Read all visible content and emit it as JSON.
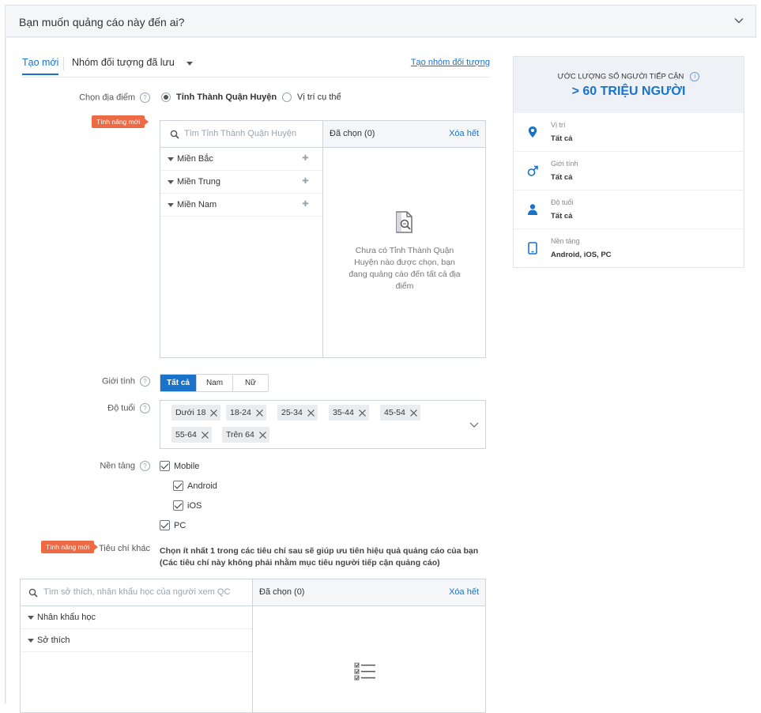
{
  "header": {
    "title": "Bạn muốn quảng cáo này đến ai?"
  },
  "tabs": {
    "new": "Tạo mới",
    "saved": "Nhóm đối tượng đã lưu",
    "create_link": "Tạo nhóm đối tượng"
  },
  "location": {
    "label": "Chọn địa điểm",
    "new_badge": "Tính năng mới",
    "options": [
      "Tỉnh Thành Quận Huyện",
      "Vị trí cụ thể"
    ],
    "search_placeholder": "Tìm Tỉnh Thành Quận Huyện",
    "regions": [
      "Miền Bắc",
      "Miền Trung",
      "Miền Nam"
    ],
    "selected_label": "Đã chọn (0)",
    "clear_all": "Xóa hết",
    "empty_message": "Chưa có Tỉnh Thành Quận Huyện nào được chọn, bạn đang quảng cáo đến tất cả địa điểm"
  },
  "gender": {
    "label": "Giới tính",
    "options": [
      "Tất cả",
      "Nam",
      "Nữ"
    ],
    "selected": "Tất cả"
  },
  "age": {
    "label": "Độ tuổi",
    "chips": [
      "Dưới 18",
      "18-24",
      "25-34",
      "35-44",
      "45-54",
      "55-64",
      "Trên 64"
    ]
  },
  "platform": {
    "label": "Nền tảng",
    "items": [
      "Mobile",
      "Android",
      "iOS",
      "PC"
    ]
  },
  "criteria": {
    "badge": "Tính năng mới",
    "label": "Tiêu chí khác",
    "line1": "Chọn ít nhất 1 trong các tiêu chí sau sẽ giúp ưu tiên hiệu quả quảng cáo của bạn",
    "line2": "(Các tiêu chí này không phải nhằm mục tiêu người tiếp cận quảng cáo)",
    "search_placeholder": "Tìm sở thích, nhân khẩu học của người xem QC",
    "groups": [
      "Nhân khẩu học",
      "Sở thích"
    ],
    "selected_label": "Đã chọn (0)",
    "clear_all": "Xóa hết"
  },
  "reach": {
    "title": "ƯỚC LƯỢNG SỐ NGƯỜI TIẾP CẬN",
    "value": "> 60 TRIỆU NGƯỜI",
    "rows": [
      {
        "key": "Vị trí",
        "value": "Tất cả",
        "icon": "location-pin-icon"
      },
      {
        "key": "Giới tính",
        "value": "Tất cả",
        "icon": "male-gender-icon"
      },
      {
        "key": "Độ tuổi",
        "value": "Tất cả",
        "icon": "person-icon"
      },
      {
        "key": "Nền tảng",
        "value": "Android, iOS, PC",
        "icon": "tablet-icon"
      }
    ]
  },
  "colors": {
    "accent": "#1a73c8",
    "badge": "#ee6a45"
  }
}
